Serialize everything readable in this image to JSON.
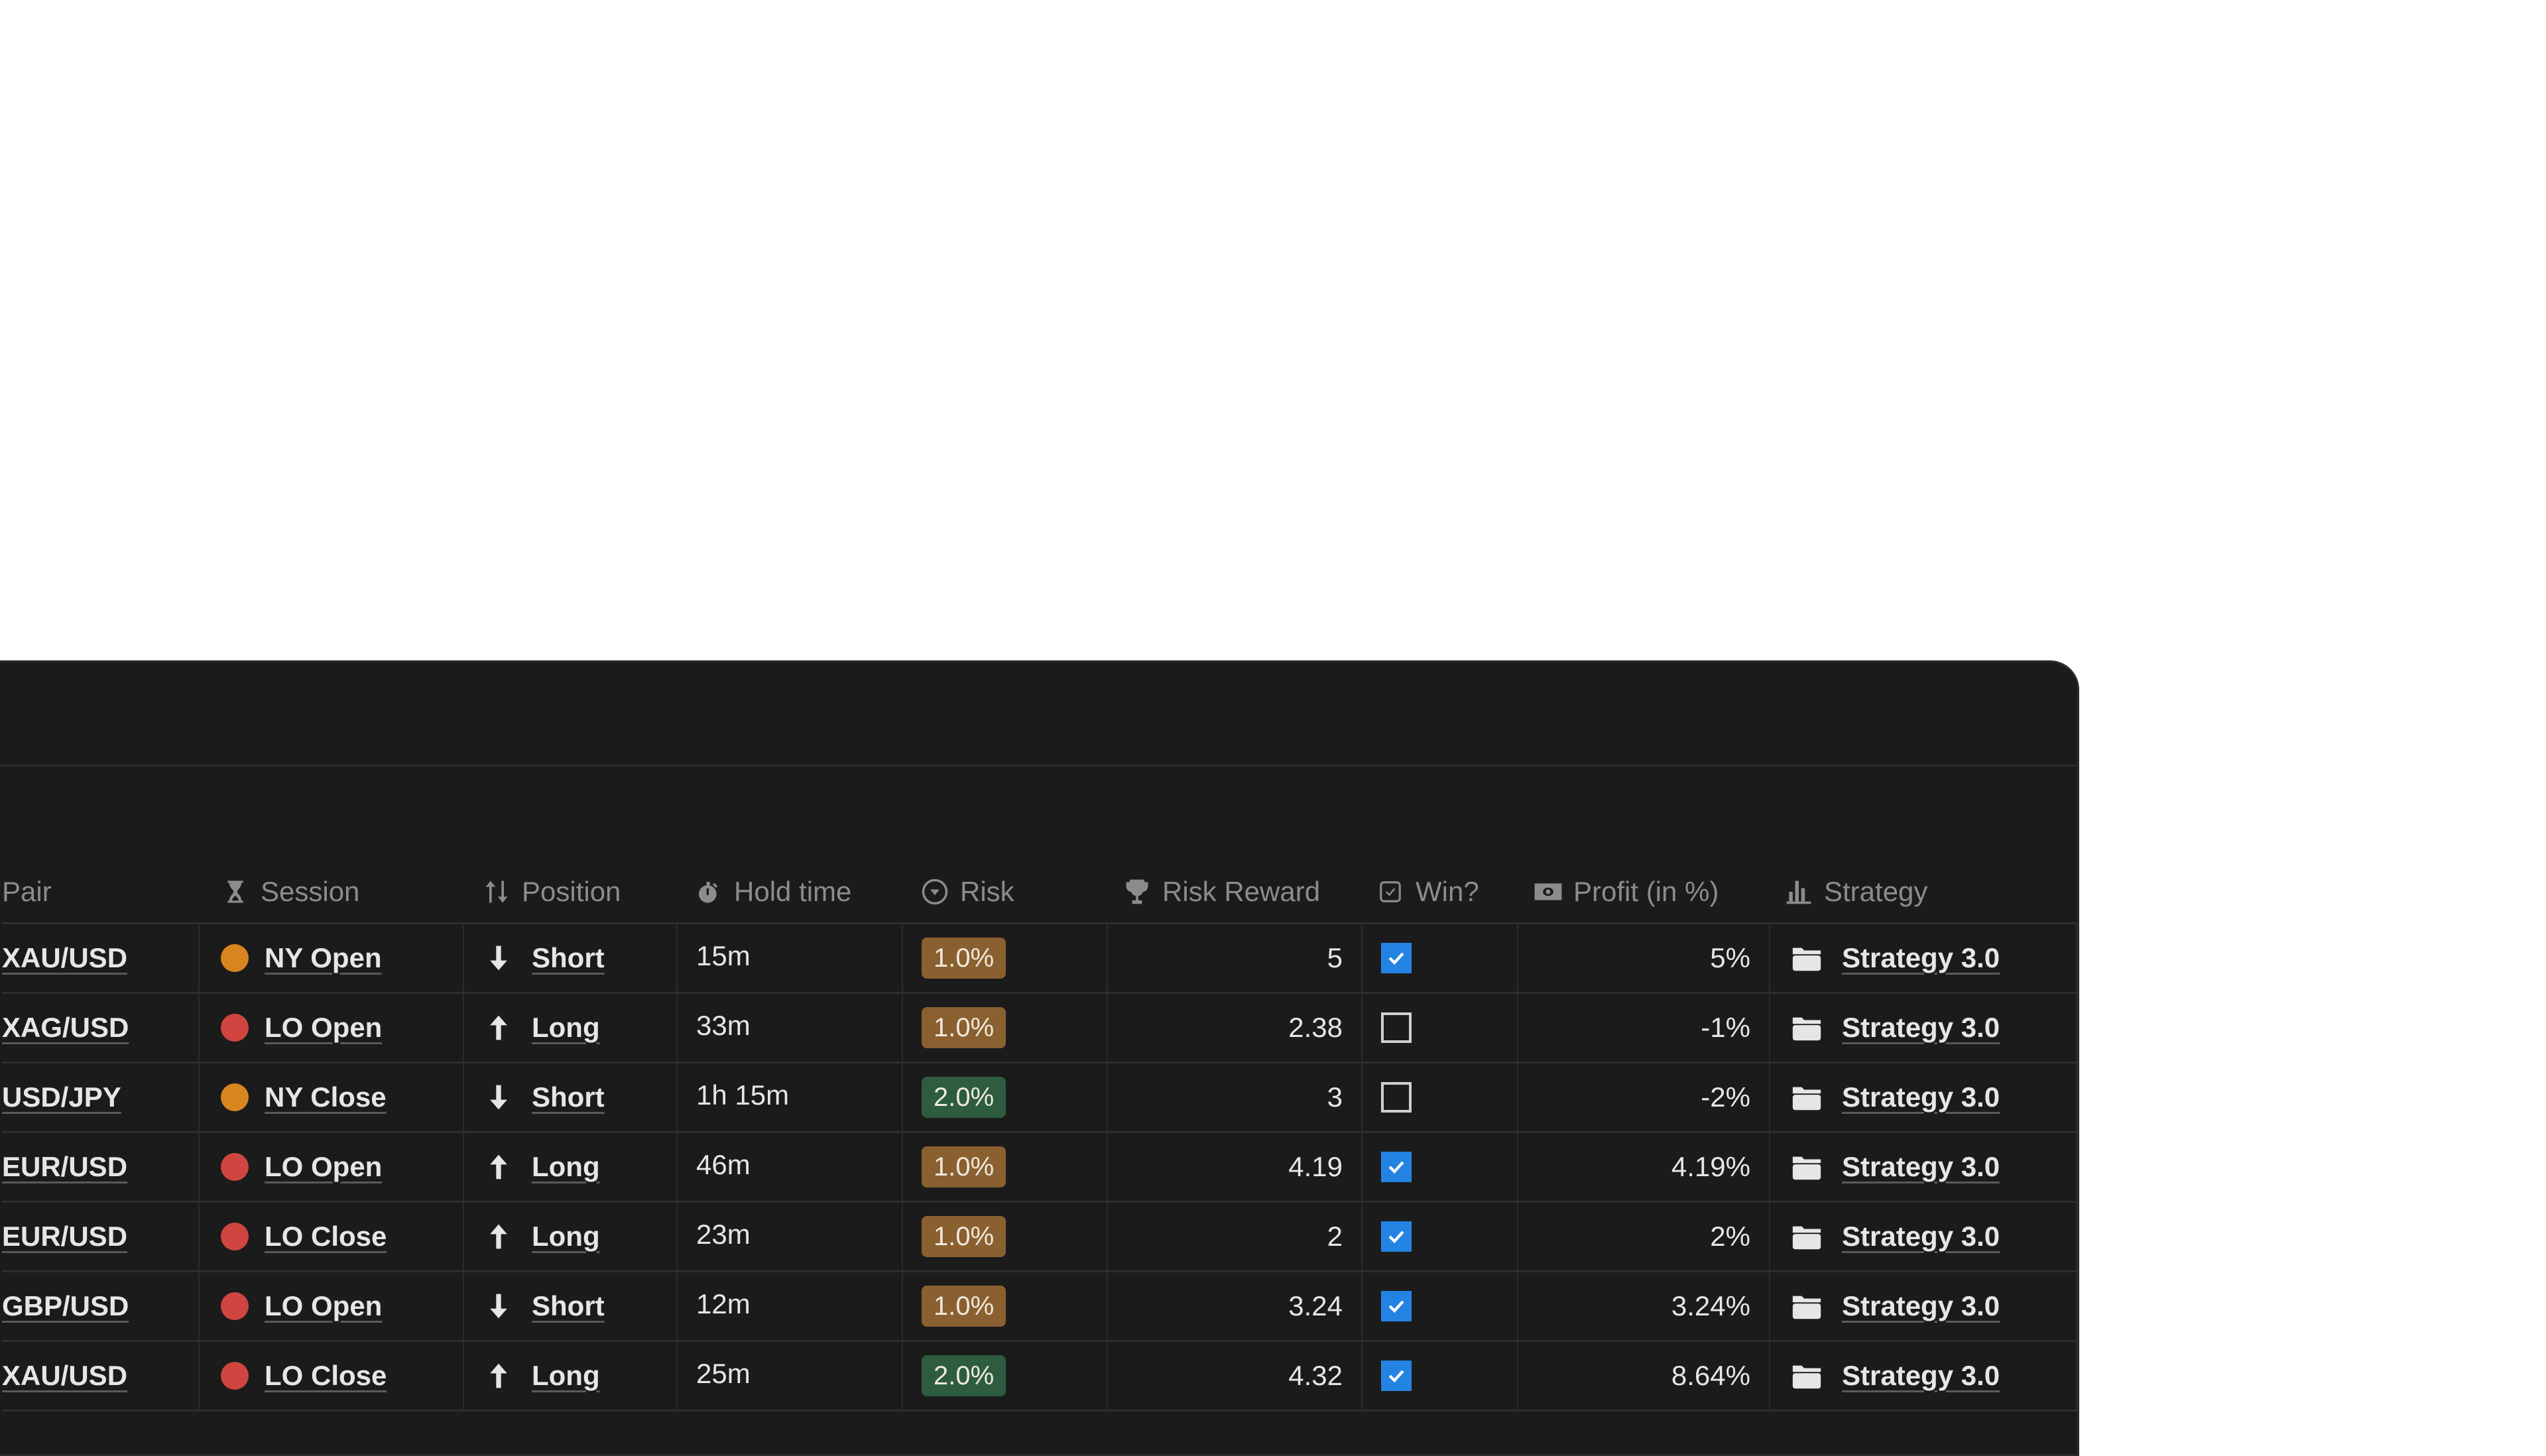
{
  "colors": {
    "panel_bg": "#1b1b1b",
    "session_ny": "#d9851f",
    "session_lo": "#d0453f",
    "risk_1": "#8a6030",
    "risk_2": "#2d5c3f",
    "checkbox_on": "#2383e2"
  },
  "table": {
    "columns": [
      {
        "key": "pair",
        "label": "Pair",
        "icon": ""
      },
      {
        "key": "session",
        "label": "Session",
        "icon": "hourglass-icon"
      },
      {
        "key": "position",
        "label": "Position",
        "icon": "sort-arrows-icon"
      },
      {
        "key": "hold_time",
        "label": "Hold time",
        "icon": "stopwatch-icon"
      },
      {
        "key": "risk",
        "label": "Risk",
        "icon": "select-circle-icon"
      },
      {
        "key": "risk_reward",
        "label": "Risk Reward",
        "icon": "trophy-icon"
      },
      {
        "key": "win",
        "label": "Win?",
        "icon": "checkbox-icon"
      },
      {
        "key": "profit",
        "label": "Profit (in %)",
        "icon": "money-icon"
      },
      {
        "key": "strategy",
        "label": "Strategy",
        "icon": "bar-chart-icon"
      }
    ],
    "rows": [
      {
        "pair": "XAU/USD",
        "session": "NY Open",
        "session_color": "ny",
        "position": "Short",
        "direction": "down",
        "hold_time": "15m",
        "risk": "1.0%",
        "risk_color": "1",
        "risk_reward": "5",
        "win": true,
        "profit": "5%",
        "strategy": "Strategy 3.0"
      },
      {
        "pair": "XAG/USD",
        "session": "LO Open",
        "session_color": "lo",
        "position": "Long",
        "direction": "up",
        "hold_time": "33m",
        "risk": "1.0%",
        "risk_color": "1",
        "risk_reward": "2.38",
        "win": false,
        "profit": "-1%",
        "strategy": "Strategy 3.0"
      },
      {
        "pair": "USD/JPY",
        "session": "NY Close",
        "session_color": "ny",
        "position": "Short",
        "direction": "down",
        "hold_time": "1h 15m",
        "risk": "2.0%",
        "risk_color": "2",
        "risk_reward": "3",
        "win": false,
        "profit": "-2%",
        "strategy": "Strategy 3.0"
      },
      {
        "pair": "EUR/USD",
        "session": "LO Open",
        "session_color": "lo",
        "position": "Long",
        "direction": "up",
        "hold_time": "46m",
        "risk": "1.0%",
        "risk_color": "1",
        "risk_reward": "4.19",
        "win": true,
        "profit": "4.19%",
        "strategy": "Strategy 3.0"
      },
      {
        "pair": "EUR/USD",
        "session": "LO Close",
        "session_color": "lo",
        "position": "Long",
        "direction": "up",
        "hold_time": "23m",
        "risk": "1.0%",
        "risk_color": "1",
        "risk_reward": "2",
        "win": true,
        "profit": "2%",
        "strategy": "Strategy 3.0"
      },
      {
        "pair": "GBP/USD",
        "session": "LO Open",
        "session_color": "lo",
        "position": "Short",
        "direction": "down",
        "hold_time": "12m",
        "risk": "1.0%",
        "risk_color": "1",
        "risk_reward": "3.24",
        "win": true,
        "profit": "3.24%",
        "strategy": "Strategy 3.0"
      },
      {
        "pair": "XAU/USD",
        "session": "LO Close",
        "session_color": "lo",
        "position": "Long",
        "direction": "up",
        "hold_time": "25m",
        "risk": "2.0%",
        "risk_color": "2",
        "risk_reward": "4.32",
        "win": true,
        "profit": "8.64%",
        "strategy": "Strategy 3.0"
      }
    ]
  }
}
